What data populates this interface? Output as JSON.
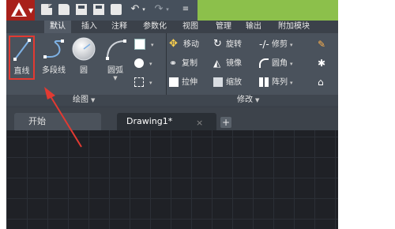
{
  "ribbon_tabs": [
    "默认",
    "插入",
    "注释",
    "参数化",
    "视图",
    "管理",
    "输出",
    "附加模块"
  ],
  "draw_panel": {
    "label": "绘图",
    "line": "直线",
    "polyline": "多段线",
    "circle": "圆",
    "arc": "圆弧"
  },
  "modify_panel": {
    "label": "修改",
    "move": "移动",
    "rotate": "旋转",
    "trim": "修剪",
    "copy": "复制",
    "mirror": "镜像",
    "fillet": "圆角",
    "stretch": "拉伸",
    "scale": "缩放",
    "array": "阵列"
  },
  "doc_tabs": {
    "start": "开始",
    "drawing": "Drawing1*",
    "close": "×",
    "add": "+"
  },
  "colors": {
    "accent": "#a8201a",
    "highlight": "#e23a32",
    "quick_access_bg": "#8cc04b"
  }
}
